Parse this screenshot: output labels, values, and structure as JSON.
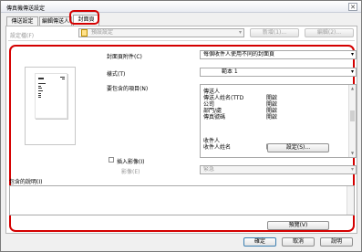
{
  "window": {
    "title": "傳真機傳送設定",
    "close_glyph": "✕"
  },
  "tabs": [
    {
      "label": "傳送設定"
    },
    {
      "label": "編輯傳送人"
    },
    {
      "label": "封面頁"
    }
  ],
  "top": {
    "preset_label": "設定檔(F)",
    "preset_value": "預設設定",
    "add_label": "新增(1)...",
    "edit_label": "編輯(2)..."
  },
  "main": {
    "attach_label": "封面頁附件(C)",
    "attach_value": "每個收件人使用不同的封面頁",
    "style_label": "樣式(T)",
    "style_value": "範本 1",
    "items_label": "要包含的項目(N)",
    "items": [
      {
        "name": "傳送人",
        "value": ""
      },
      {
        "name": "傳送人姓名(TTD",
        "value": "開啟"
      },
      {
        "name": "公司",
        "value": "開啟"
      },
      {
        "name": "部門/處",
        "value": "開啟"
      },
      {
        "name": "傳真號碼",
        "value": "開啟"
      },
      {
        "name": "",
        "value": ""
      },
      {
        "name": "收件人",
        "value": ""
      },
      {
        "name": "收件人姓名",
        "value": "開啟"
      }
    ],
    "settings_btn": "設定(S)...",
    "image_chk_label": "插入影像(I)",
    "image_label": "影像(E)",
    "image_value": "緊急",
    "comment_label": "包含的說明(I)",
    "preview_btn": "預覽(V)"
  },
  "footer": {
    "ok": "確定",
    "cancel": "取消",
    "help": "說明"
  },
  "colors": {
    "highlight": "#d40000"
  }
}
